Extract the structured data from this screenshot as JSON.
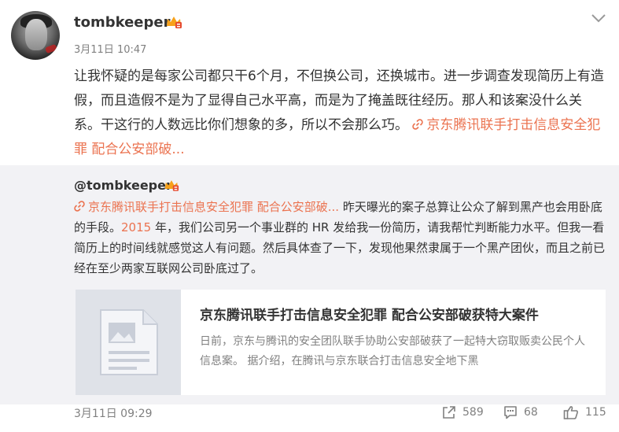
{
  "post": {
    "username": "tombkeeper",
    "timestamp": "3月11日 10:47",
    "text": "让我怀疑的是每家公司都只干6个月，不但换公司，还换城市。进一步调查发现简历上有造假，而且造假不是为了显得自己水平高，而是为了掩盖既往经历。那人和该案没什么关系。干这行的人数远比你们想象的多，所以不会那么巧。",
    "link_text": "京东腾讯联手打击信息安全犯罪 配合公安部破..."
  },
  "repost": {
    "username": "@tombkeeper",
    "link_text": "京东腾讯联手打击信息安全犯罪 配合公安部破...",
    "text_part1": " 昨天曝光的案子总算让公众了解到黑产也会用卧底的手段。",
    "year": "2015",
    "text_part2": " 年，我们公司另一个事业群的 HR 发给我一份简历，请我帮忙判断能力水平。但我一看简历上的时间线就感觉这人有问题。然后具体查了一下，发现他果然隶属于一个黑产团伙，而且之前已经在至少两家互联网公司卧底过了。",
    "card": {
      "title": "京东腾讯联手打击信息安全犯罪 配合公安部破获特大案件",
      "desc": "日前，京东与腾讯的安全团队联手协助公安部破获了一起特大窃取贩卖公民个人信息案。 据介绍，在腾讯与京东联合打击信息安全地下黑"
    }
  },
  "footer": {
    "time": "3月11日 09:29",
    "shares": "589",
    "comments": "68",
    "likes": "115"
  },
  "colors": {
    "link": "#eb7350",
    "repost_bg": "#f2f2f5",
    "muted": "#808080"
  }
}
